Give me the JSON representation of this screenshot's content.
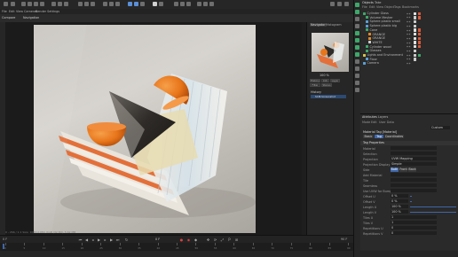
{
  "menu": {
    "items": [
      "File",
      "Edit",
      "View",
      "Cameras",
      "Display",
      "Options",
      "Filter",
      "Panel"
    ],
    "render_settings": "Render Settings",
    "compare": "Compare",
    "navigation": "Navigation"
  },
  "navigator": {
    "tabs": [
      "Navigator",
      "Histogram"
    ],
    "zoom": "100 %",
    "buttons": [
      "History",
      "Info",
      "Layer",
      "Filter",
      "Stereo"
    ],
    "history_label": "History",
    "history_entry": "SCM-Screenshot"
  },
  "viewport": {
    "info_line": "0 - 266 / 1:1 Size: 1080x1080, RGB (32 Bit), 5.62 MB"
  },
  "timeline": {
    "frame_start": "0 F",
    "frame_end": "90 F",
    "current_frame": "0 F",
    "ruler_ticks": [
      "0",
      "5",
      "10",
      "15",
      "20",
      "25",
      "30",
      "35",
      "40",
      "45",
      "50",
      "55",
      "60",
      "65",
      "70",
      "75",
      "80",
      "85",
      "90"
    ]
  },
  "objects_panel": {
    "tabs": [
      "Objects",
      "Take"
    ],
    "menu": [
      "File",
      "Edit",
      "View",
      "Object",
      "Tags",
      "Bookmarks"
    ],
    "rows": [
      {
        "name": "Cylinder Glass",
        "indent": 0,
        "icon_color": "#3ea86b",
        "tags": [
          "#e0e0e0",
          "#d95a3a"
        ]
      },
      {
        "name": "Volume Mesher",
        "indent": 1,
        "icon_color": "#3ea86b",
        "tags": [
          "#cccccc",
          "#d95a3a"
        ]
      },
      {
        "name": "Sphere plastic small",
        "indent": 1,
        "icon_color": "#5aa0d8",
        "tags": [
          "#cccccc"
        ]
      },
      {
        "name": "Sphere plastic big",
        "indent": 1,
        "icon_color": "#5aa0d8",
        "tags": [
          "#cccccc"
        ]
      },
      {
        "name": "Cone",
        "indent": 1,
        "icon_color": "#3ea86b",
        "tags": [
          "#e0e0e0",
          "#d95a3a"
        ]
      },
      {
        "name": "ORANGE",
        "indent": 2,
        "icon_color": "#e08a2a",
        "tags": [
          "#e0e0e0",
          "#d95a3a"
        ]
      },
      {
        "name": "ORANGE",
        "indent": 2,
        "icon_color": "#e08a2a",
        "tags": [
          "#e0e0e0",
          "#d95a3a"
        ]
      },
      {
        "name": "WHITE",
        "indent": 2,
        "icon_color": "#cccccc",
        "tags": [
          "#e0e0e0",
          "#d95a3a"
        ]
      },
      {
        "name": "Cylinder wood",
        "indent": 1,
        "icon_color": "#3ea86b",
        "tags": [
          "#e0e0e0",
          "#d95a3a"
        ]
      },
      {
        "name": "Glasses",
        "indent": 1,
        "icon_color": "#3ea86b",
        "tags": [
          "#cccccc"
        ]
      },
      {
        "name": "Lights and Environment",
        "indent": 0,
        "icon_color": "#d8c24a",
        "tags": [
          "#cccccc",
          "#3ea86b"
        ]
      },
      {
        "name": "Floor",
        "indent": 1,
        "icon_color": "#5aa0d8",
        "tags": [
          "#cccccc"
        ]
      },
      {
        "name": "Camera",
        "indent": 0,
        "icon_color": "#5aa0d8",
        "tags": []
      }
    ]
  },
  "attributes_panel": {
    "tabs": [
      "Attributes",
      "Layers"
    ],
    "menu": [
      "Mode",
      "Edit",
      "User Data"
    ],
    "mode_select": "Custom",
    "title": "Material Tag [Material]",
    "subtabs": [
      "Basic",
      "Tag",
      "Coordinates"
    ],
    "section": "Tag Properties",
    "rows": [
      {
        "label": "Material",
        "value": ""
      },
      {
        "label": "Selection",
        "value": ""
      },
      {
        "label": "Projection",
        "value": "UVW Mapping"
      },
      {
        "label": "Projection Display",
        "value": "Simple"
      },
      {
        "label": "Side",
        "value": ""
      },
      {
        "label": "Add Material",
        "value": ""
      },
      {
        "label": "Tile",
        "value": ""
      },
      {
        "label": "Seamless",
        "value": ""
      },
      {
        "label": "Use UVW for Bump",
        "value": ""
      },
      {
        "label": "Offset U",
        "value": "0 %",
        "fill": 0
      },
      {
        "label": "Offset V",
        "value": "0 %",
        "fill": 0
      },
      {
        "label": "Length U",
        "value": "100 %",
        "fill": 1
      },
      {
        "label": "Length V",
        "value": "100 %",
        "fill": 1
      },
      {
        "label": "Tiles U",
        "value": "1"
      },
      {
        "label": "Tiles V",
        "value": "1"
      },
      {
        "label": "Repetitions U",
        "value": "0"
      },
      {
        "label": "Repetitions V",
        "value": "0"
      }
    ],
    "side_buttons": [
      "Both",
      "Front",
      "Back"
    ]
  },
  "colors": {
    "accent": "#3f66a8",
    "orange": "#e8751a"
  }
}
